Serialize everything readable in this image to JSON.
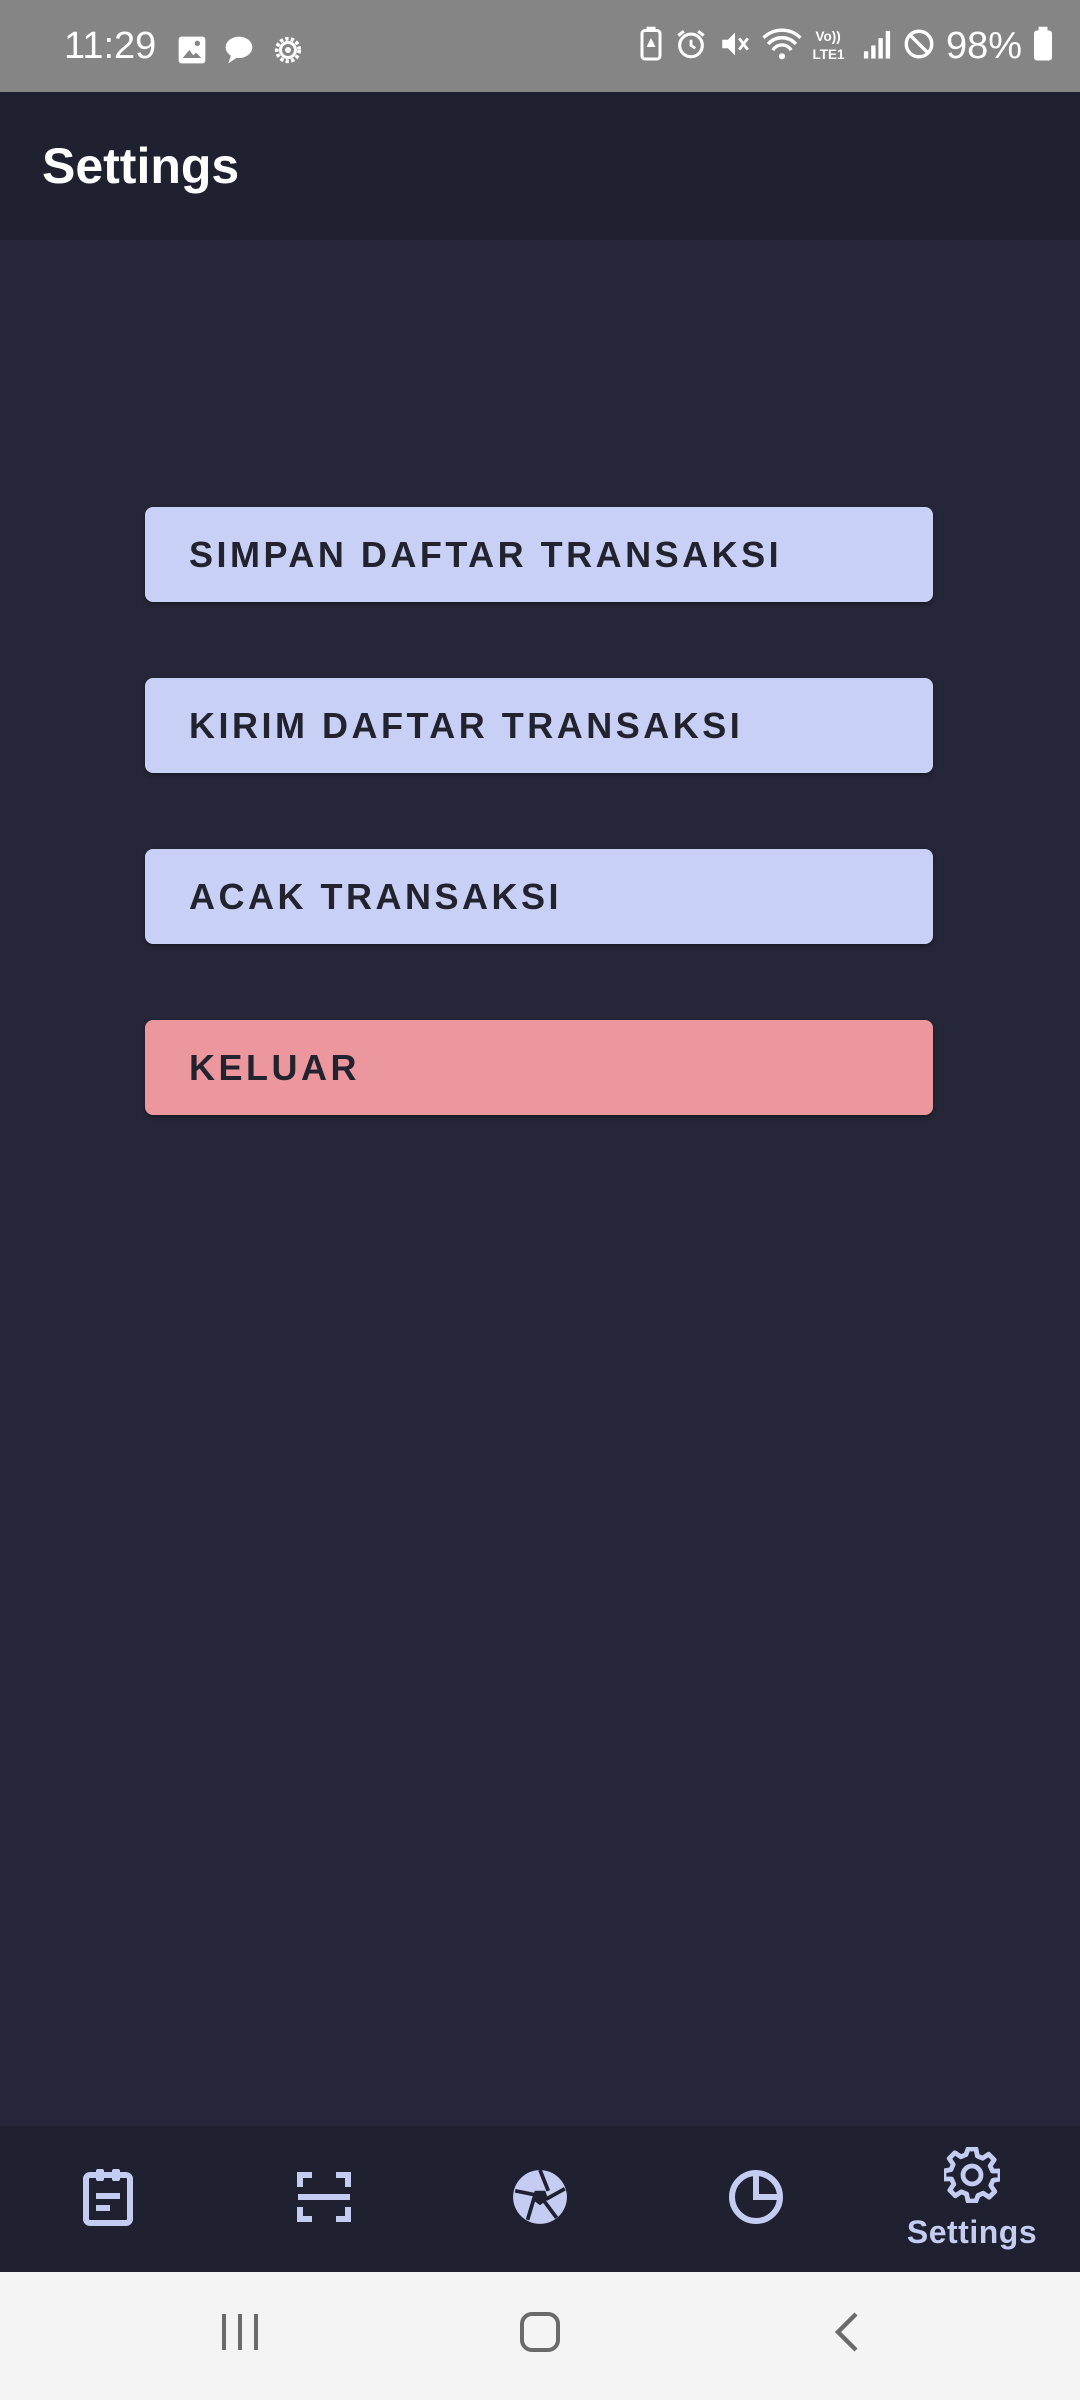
{
  "status_bar": {
    "time": "11:29",
    "battery_percent": "98%",
    "left_icons": [
      "image-icon",
      "chat-bubble-icon",
      "settings-gear-icon"
    ],
    "right_icons": [
      "battery-saver-icon",
      "alarm-icon",
      "mute-icon",
      "wifi-icon",
      "volte-icon",
      "signal-icon",
      "do-not-disturb-icon",
      "battery-icon"
    ]
  },
  "app_bar": {
    "title": "Settings"
  },
  "actions": {
    "save_label": "SIMPAN DAFTAR TRANSAKSI",
    "send_label": "KIRIM DAFTAR TRANSAKSI",
    "shuffle_label": "ACAK TRANSAKSI",
    "logout_label": "KELUAR"
  },
  "bottom_nav": {
    "items": [
      {
        "icon": "transactions-list-icon",
        "label": ""
      },
      {
        "icon": "scan-icon",
        "label": ""
      },
      {
        "icon": "camera-shutter-icon",
        "label": ""
      },
      {
        "icon": "pie-chart-icon",
        "label": ""
      },
      {
        "icon": "gear-icon",
        "label": "Settings",
        "selected": true
      }
    ]
  },
  "colors": {
    "background": "#252738",
    "app_bar": "#1f2130",
    "button": "#c8d0f5",
    "danger_button": "#ec979e",
    "nav_icon": "#c5ccf2"
  }
}
